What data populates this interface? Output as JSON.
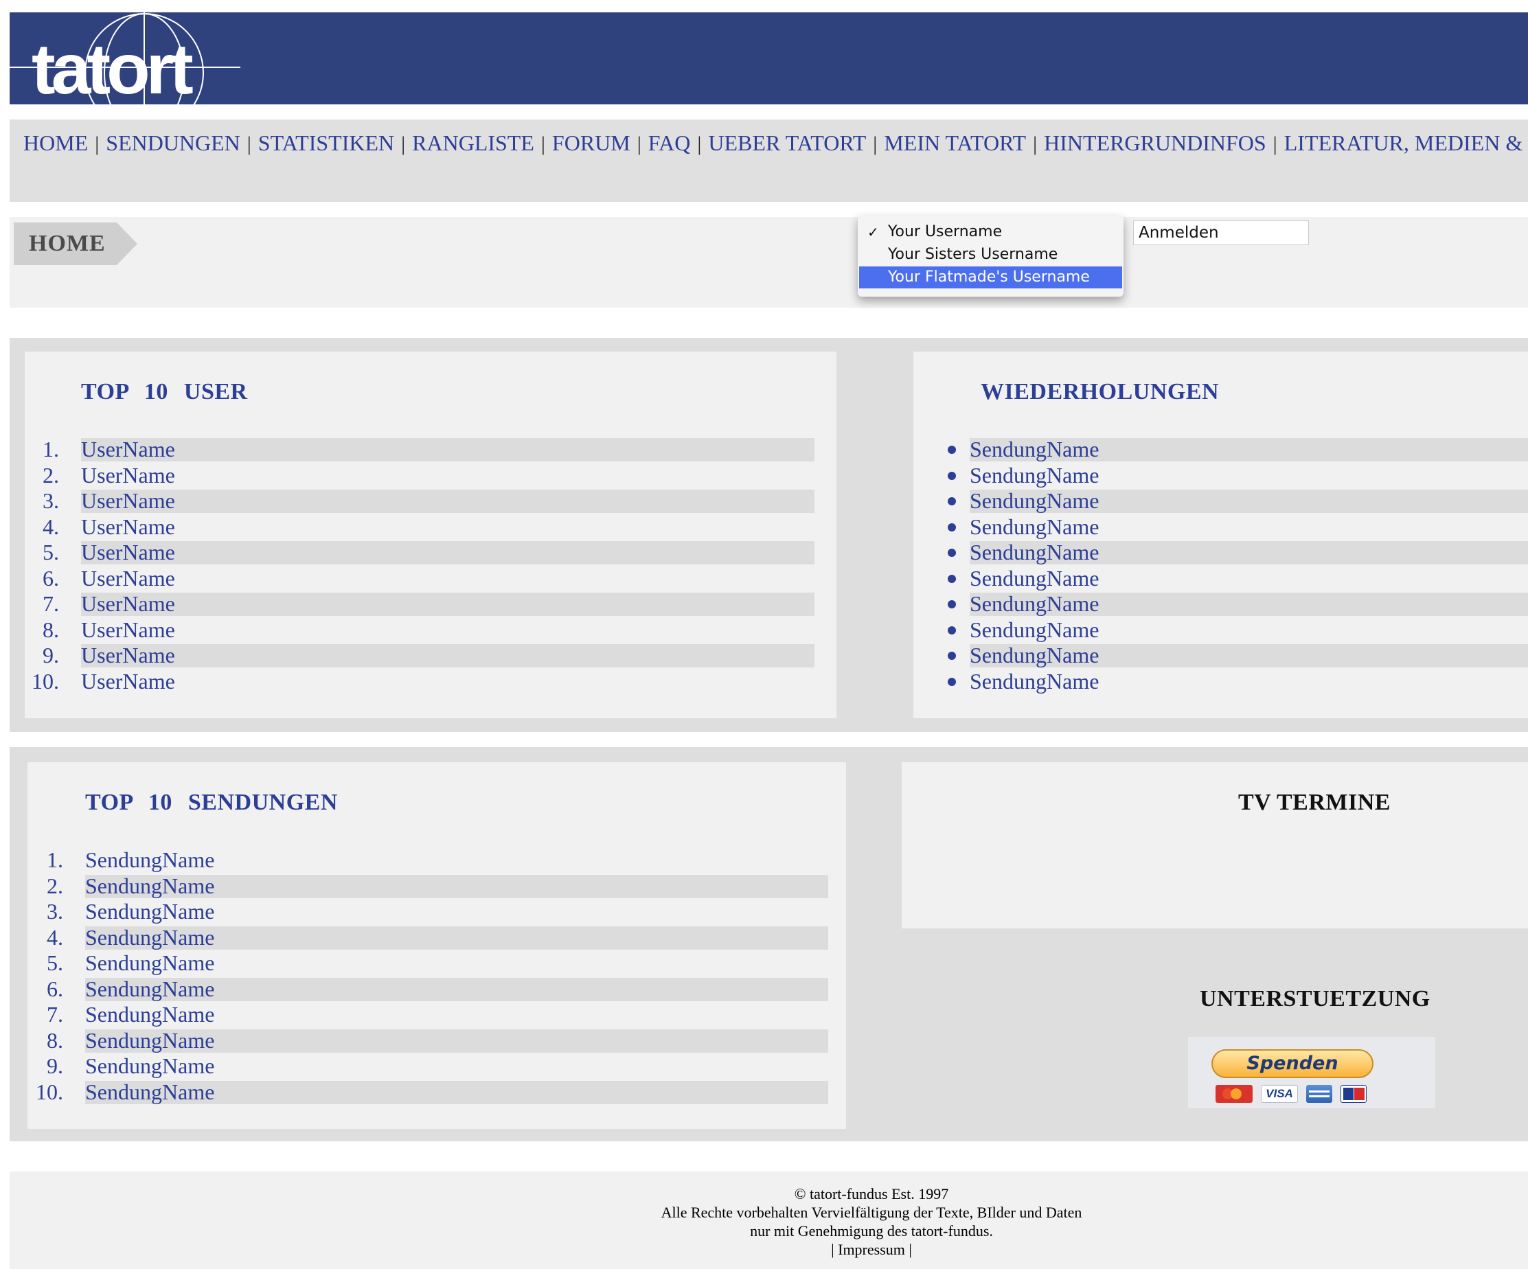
{
  "header": {
    "logo_text": "tatort"
  },
  "nav": {
    "links": [
      "HOME",
      "SENDUNGEN",
      "STATISTIKEN",
      "RANGLISTE",
      "FORUM",
      "FAQ",
      "UEBER TATORT",
      "MEIN TATORT",
      "HINTERGRUNDINFOS",
      "LITERATUR, MEDIEN & FANA"
    ],
    "separator": "|"
  },
  "breadcrumb": {
    "label": "HOME"
  },
  "login": {
    "options": [
      {
        "label": "Your Username",
        "checked": true,
        "highlighted": false
      },
      {
        "label": "Your Sisters Username",
        "checked": false,
        "highlighted": false
      },
      {
        "label": "Your Flatmade's Username",
        "checked": false,
        "highlighted": true
      }
    ],
    "field_value": "Anmelden"
  },
  "top_users": {
    "title": "TOP 10 USER",
    "items": [
      "UserName",
      "UserName",
      "UserName",
      "UserName",
      "UserName",
      "UserName",
      "UserName",
      "UserName",
      "UserName",
      "UserName"
    ]
  },
  "wiederholungen": {
    "title": "WIEDERHOLUNGEN",
    "items": [
      "SendungName",
      "SendungName",
      "SendungName",
      "SendungName",
      "SendungName",
      "SendungName",
      "SendungName",
      "SendungName",
      "SendungName",
      "SendungName"
    ]
  },
  "top_sendungen": {
    "title": "TOP 10 SENDUNGEN",
    "items": [
      "SendungName",
      "SendungName",
      "SendungName",
      "SendungName",
      "SendungName",
      "SendungName",
      "SendungName",
      "SendungName",
      "SendungName",
      "SendungName"
    ]
  },
  "tv_termine": {
    "title": "TV TERMINE"
  },
  "support": {
    "title": "UNTERSTUETZUNG",
    "donate_label": "Spenden",
    "payment_icons": [
      "mastercard-icon",
      "visa-icon",
      "amex-icon",
      "maestro-ec-icon"
    ],
    "card_labels": {
      "visa": "VISA"
    }
  },
  "footer": {
    "copyright": "© tatort-fundus Est. 1997",
    "rights_line1": "Alle Rechte vorbehalten Vervielfältigung der Texte, BIlder und Daten",
    "rights_line2": "nur mit Genehmigung des tatort-fundus.",
    "impressum": "| Impressum |"
  },
  "colors": {
    "header_bg": "#30427e",
    "link": "#2c3e96",
    "highlight": "#4c6ff0"
  }
}
